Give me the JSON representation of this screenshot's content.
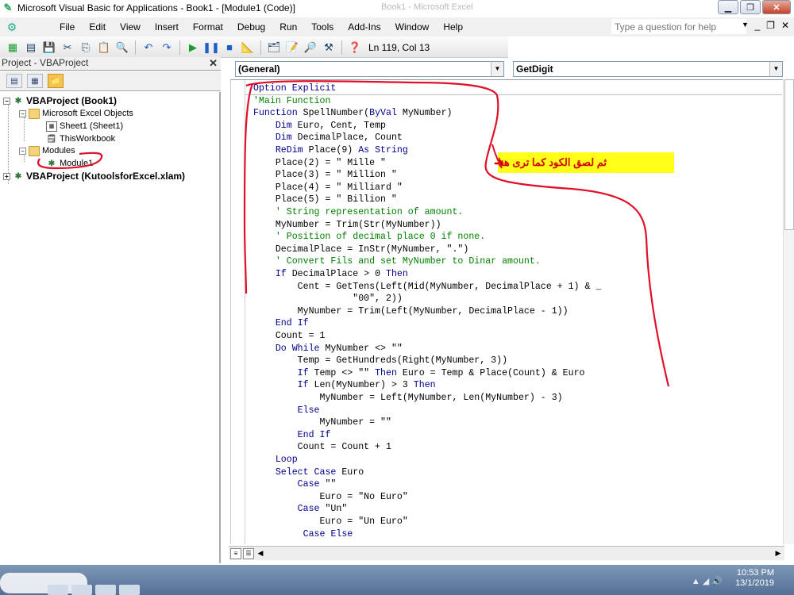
{
  "window": {
    "title": "Microsoft Visual Basic for Applications - Book1 - [Module1 (Code)]",
    "background_title": "Book1 - Microsoft Excel"
  },
  "menu": {
    "items": [
      "File",
      "Edit",
      "View",
      "Insert",
      "Format",
      "Debug",
      "Run",
      "Tools",
      "Add-Ins",
      "Window",
      "Help"
    ],
    "help_placeholder": "Type a question for help"
  },
  "toolbar": {
    "cursor_position": "Ln 119, Col 13"
  },
  "project_pane": {
    "title": "Project - VBAProject",
    "tree": {
      "project1": "VBAProject (Book1)",
      "excel_objects": "Microsoft Excel Objects",
      "sheet1": "Sheet1 (Sheet1)",
      "thisworkbook": "ThisWorkbook",
      "modules": "Modules",
      "module1": "Module1",
      "project2": "VBAProject (KutoolsforExcel.xlam)"
    }
  },
  "code_window": {
    "object_dropdown": "(General)",
    "procedure_dropdown": "GetDigit",
    "lines": [
      "Option Explicit",
      "'Main Function",
      "Function SpellNumber(ByVal MyNumber)",
      "    Dim Euro, Cent, Temp",
      "    Dim DecimalPlace, Count",
      "    ReDim Place(9) As String",
      "    Place(2) = \" Mille \"",
      "    Place(3) = \" Million \"",
      "    Place(4) = \" Milliard \"",
      "    Place(5) = \" Billion \"",
      "    ' String representation of amount.",
      "    MyNumber = Trim(Str(MyNumber))",
      "    ' Position of decimal place 0 if none.",
      "    DecimalPlace = InStr(MyNumber, \".\")",
      "    ' Convert Fils and set MyNumber to Dinar amount.",
      "    If DecimalPlace > 0 Then",
      "        Cent = GetTens(Left(Mid(MyNumber, DecimalPlace + 1) & _",
      "                  \"00\", 2))",
      "        MyNumber = Trim(Left(MyNumber, DecimalPlace - 1))",
      "    End If",
      "    Count = 1",
      "    Do While MyNumber <> \"\"",
      "        Temp = GetHundreds(Right(MyNumber, 3))",
      "        If Temp <> \"\" Then Euro = Temp & Place(Count) & Euro",
      "        If Len(MyNumber) > 3 Then",
      "            MyNumber = Left(MyNumber, Len(MyNumber) - 3)",
      "        Else",
      "            MyNumber = \"\"",
      "        End If",
      "        Count = Count + 1",
      "    Loop",
      "    Select Case Euro",
      "        Case \"\"",
      "            Euro = \"No Euro\"",
      "        Case \"Un\"",
      "            Euro = \"Un Euro\"",
      "         Case Else"
    ]
  },
  "annotation": {
    "text": "ثم لصق الكود كما ترى هنا",
    "color": "#d40000",
    "background": "#ffff1a"
  },
  "taskbar": {
    "time": "10:53 PM",
    "date": "13/1/2019"
  },
  "colors": {
    "keyword": "#00008b",
    "comment": "#008000",
    "scribble": "#e0102a"
  }
}
